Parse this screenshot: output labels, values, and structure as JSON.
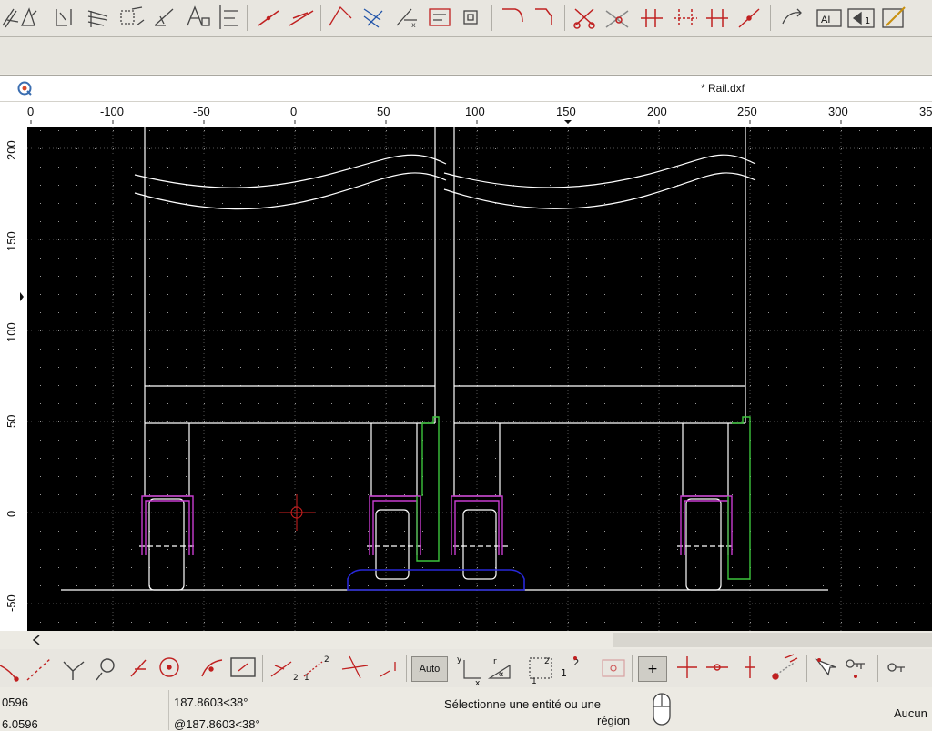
{
  "document": {
    "tab_title": "* Rail.dxf"
  },
  "ruler_h_labels": [
    "0",
    "-100",
    "-50",
    "0",
    "50",
    "100",
    "150",
    "200",
    "250",
    "300",
    "35"
  ],
  "ruler_v_labels": [
    "200",
    "150",
    "100",
    "50",
    "0",
    "-50"
  ],
  "snap_toolbar": {
    "auto_label": "Auto",
    "plus_label": "+"
  },
  "status": {
    "coord_abs_x": "0596",
    "coord_rel_x": "6.0596",
    "coord_abs_polar": "187.8603<38°",
    "coord_rel_polar": "@187.8603<38°",
    "prompt_line1": "Sélectionne une entité ou une",
    "prompt_line2": "région",
    "selection": "Aucun"
  },
  "colors": {
    "canvas_bg": "#000000",
    "entity_white": "#ffffff",
    "magenta": "#c83ccf",
    "green": "#3cc43c",
    "blue": "#2828d8",
    "cursor_red": "#d22020",
    "grid_dot": "#9a9a9a"
  },
  "icons": {
    "top_toolbar": [
      "dimension-aligned-icon",
      "dimension-angle-icon",
      "dimension-linear-icon",
      "hatch-icon",
      "leader-icon",
      "dimension-radial-icon",
      "text-icon",
      "align-icon",
      "line-icon",
      "parallel-line-icon",
      "polyline-icon",
      "offset-icon",
      "trim-icon",
      "block-icon",
      "scale-icon",
      "fillet-icon",
      "chamfer-icon",
      "cut-icon",
      "trim-two-icon",
      "divide-icon",
      "break-icon",
      "mirror-icon",
      "stretch-icon",
      "rotate-icon",
      "text-edit-icon",
      "block-insert-icon",
      "properties-icon"
    ],
    "snap_toolbar": [
      "snap-endpoint-icon",
      "snap-on-entity-icon",
      "snap-intersection-icon",
      "snap-center-icon",
      "snap-middle-icon",
      "snap-distance-icon",
      "snap-perpendicular-icon",
      "snap-rectangle-icon",
      "restrict-horizontal-icon",
      "restrict-vertical-icon",
      "restrict-orthogonal-icon",
      "restrict-nothing-icon",
      "relative-zero-icon",
      "lock-relative-zero-icon",
      "grid-icon",
      "move-relative-icon",
      "snap-on-line-icon",
      "snap-on-line-point-icon",
      "snap-vertical-icon",
      "snap-angle-icon",
      "select-pointer-icon",
      "key-icon",
      "small-key-icon"
    ]
  }
}
